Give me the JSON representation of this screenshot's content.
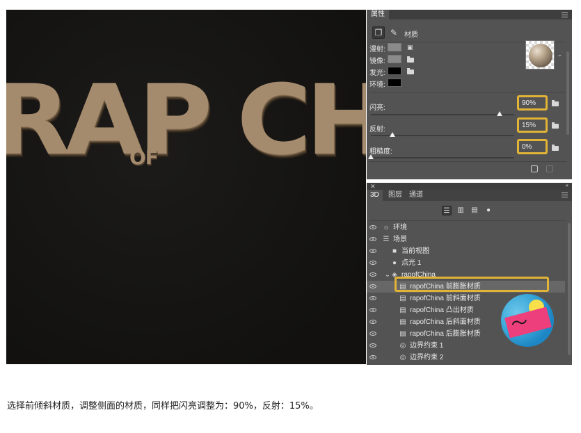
{
  "canvas": {
    "art_text_main": "RAP CHI",
    "art_text_of": "OF"
  },
  "properties": {
    "title": "属性",
    "tool_label": "材质",
    "rows": {
      "diffuse": "漫射:",
      "specular": "镜像:",
      "glow": "发光:",
      "ambient": "环境:"
    },
    "sliders": [
      {
        "label": "闪亮:",
        "value": "90%",
        "level": 0.9
      },
      {
        "label": "反射:",
        "value": "15%",
        "level": 0.15
      },
      {
        "label": "粗糙度:",
        "value": "0%",
        "level": 0.0
      }
    ]
  },
  "panel3d": {
    "tabs": [
      "3D",
      "图层",
      "通道"
    ],
    "tree": [
      {
        "icon": "environment-icon",
        "glyph": "☼",
        "label": "环境",
        "indent": 0
      },
      {
        "icon": "scene-icon",
        "glyph": "☰",
        "label": "场景",
        "indent": 0
      },
      {
        "icon": "camera-icon",
        "glyph": "■",
        "label": "当前视图",
        "indent": 1
      },
      {
        "icon": "light-bulb-icon",
        "glyph": "●",
        "label": "点光 1",
        "indent": 1
      },
      {
        "icon": "mesh-icon",
        "glyph": "◈",
        "label": "rapofChina",
        "indent": 1,
        "expand": "⌄"
      },
      {
        "icon": "material-icon",
        "glyph": "▤",
        "label": "rapofChina 前膨胀材质",
        "indent": 2,
        "selected": true
      },
      {
        "icon": "material-icon",
        "glyph": "▤",
        "label": "rapofChina 前斜面材质",
        "indent": 2
      },
      {
        "icon": "material-icon",
        "glyph": "▤",
        "label": "rapofChina 凸出材质",
        "indent": 2
      },
      {
        "icon": "material-icon",
        "glyph": "▤",
        "label": "rapofChina 后斜面材质",
        "indent": 2
      },
      {
        "icon": "material-icon",
        "glyph": "▤",
        "label": "rapofChina 后膨胀材质",
        "indent": 2
      },
      {
        "icon": "constraint-icon",
        "glyph": "◎",
        "label": "边界约束 1",
        "indent": 2
      },
      {
        "icon": "constraint-icon",
        "glyph": "◎",
        "label": "边界约束 2",
        "indent": 2
      }
    ]
  },
  "caption": "选择前倾斜材质，调整侧面的材质，同样把闪亮调整为：90%，反射：15%。",
  "colors": {
    "highlight": "#e1b437",
    "panel_bg": "#535353",
    "text_gold": "#a58b6d"
  }
}
